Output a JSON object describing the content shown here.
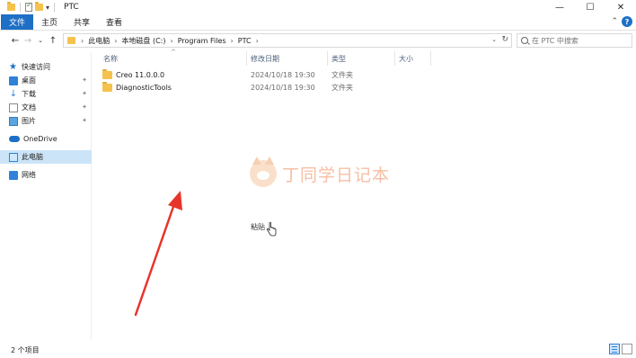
{
  "window": {
    "title": "PTC",
    "controls": {
      "minimize": "—",
      "maximize": "☐",
      "close": "✕"
    }
  },
  "ribbon": {
    "tabs": [
      "文件",
      "主页",
      "共享",
      "查看"
    ],
    "collapse_glyph": "⌃",
    "help_glyph": "?"
  },
  "nav": {
    "back": "←",
    "forward": "→",
    "recent": "⌄",
    "up": "↑"
  },
  "address": {
    "crumbs": [
      "此电脑",
      "本地磁盘 (C:)",
      "Program Files",
      "PTC"
    ],
    "separator": "›",
    "dropdown": "⌄",
    "refresh": "↻"
  },
  "search": {
    "placeholder": "在 PTC 中搜索"
  },
  "sidebar": {
    "items": [
      {
        "label": "快速访问",
        "icon": "star-icon"
      },
      {
        "label": "桌面",
        "icon": "desktop-icon"
      },
      {
        "label": "下载",
        "icon": "download-icon"
      },
      {
        "label": "文档",
        "icon": "document-icon"
      },
      {
        "label": "图片",
        "icon": "picture-icon"
      },
      {
        "label": "OneDrive",
        "icon": "cloud-icon"
      },
      {
        "label": "此电脑",
        "icon": "computer-icon"
      },
      {
        "label": "网络",
        "icon": "network-icon"
      }
    ],
    "pin_glyph": "📌"
  },
  "columns": {
    "name": "名称",
    "date": "修改日期",
    "type": "类型",
    "size": "大小"
  },
  "files": [
    {
      "name": "Creo 11.0.0.0",
      "date": "2024/10/18 19:30",
      "type": "文件夹"
    },
    {
      "name": "DiagnosticTools",
      "date": "2024/10/18 19:30",
      "type": "文件夹"
    }
  ],
  "context": {
    "paste_label": "粘贴"
  },
  "watermark": {
    "text": "丁同学日记本"
  },
  "status": {
    "count": "2 个项目"
  },
  "colors": {
    "accent": "#1e6fc6",
    "selection": "#cce4f7",
    "folder": "#f4c24d",
    "arrow": "#e8352b"
  }
}
